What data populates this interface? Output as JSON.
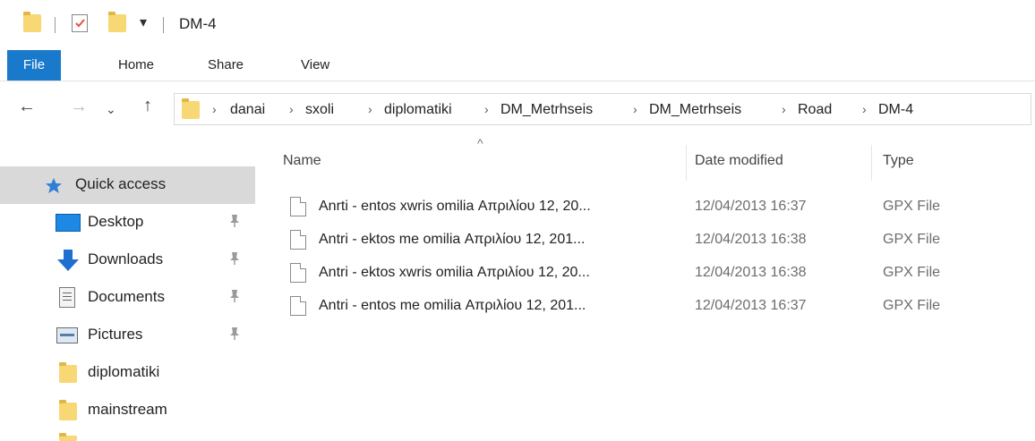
{
  "window": {
    "title": "DM-4"
  },
  "quick_access_toolbar": {
    "dropdown_glyph": "▾"
  },
  "ribbon": {
    "tabs": [
      {
        "label": "File"
      },
      {
        "label": "Home"
      },
      {
        "label": "Share"
      },
      {
        "label": "View"
      }
    ]
  },
  "nav": {
    "back": "←",
    "forward": "→",
    "recent": "⌄",
    "up": "↑"
  },
  "breadcrumb": [
    "danai",
    "sxoli",
    "diplomatiki",
    "DM_Metrhseis",
    "DM_Metrhseis",
    "Road",
    "DM-4"
  ],
  "columns": {
    "sort_indicator": "^",
    "name": "Name",
    "date": "Date modified",
    "type": "Type"
  },
  "sidebar": {
    "items": [
      {
        "label": "Quick access",
        "icon": "star-icon",
        "pinned": false,
        "active": true
      },
      {
        "label": "Desktop",
        "icon": "desktop-icon",
        "pinned": true
      },
      {
        "label": "Downloads",
        "icon": "download-arrow-icon",
        "pinned": true
      },
      {
        "label": "Documents",
        "icon": "documents-icon",
        "pinned": true
      },
      {
        "label": "Pictures",
        "icon": "pictures-icon",
        "pinned": true
      },
      {
        "label": "diplomatiki",
        "icon": "folder-icon",
        "pinned": false
      },
      {
        "label": "mainstream",
        "icon": "folder-icon",
        "pinned": false
      }
    ]
  },
  "files": [
    {
      "name": "Anrti - entos xwris omilia Απριλίου 12, 20...",
      "date": "12/04/2013 16:37",
      "type": "GPX File"
    },
    {
      "name": "Antri - ektos me omilia Απριλίου 12, 201...",
      "date": "12/04/2013 16:38",
      "type": "GPX File"
    },
    {
      "name": "Antri - ektos xwris omilia Απριλίου 12, 20...",
      "date": "12/04/2013 16:38",
      "type": "GPX File"
    },
    {
      "name": "Antri - entos me omilia Απριλίου 12, 201...",
      "date": "12/04/2013 16:37",
      "type": "GPX File"
    }
  ],
  "colors": {
    "file_tab": "#1979ca",
    "selection": "#d9d9d9",
    "folder": "#f8d775",
    "quick_access_star": "#2f7fd6"
  }
}
